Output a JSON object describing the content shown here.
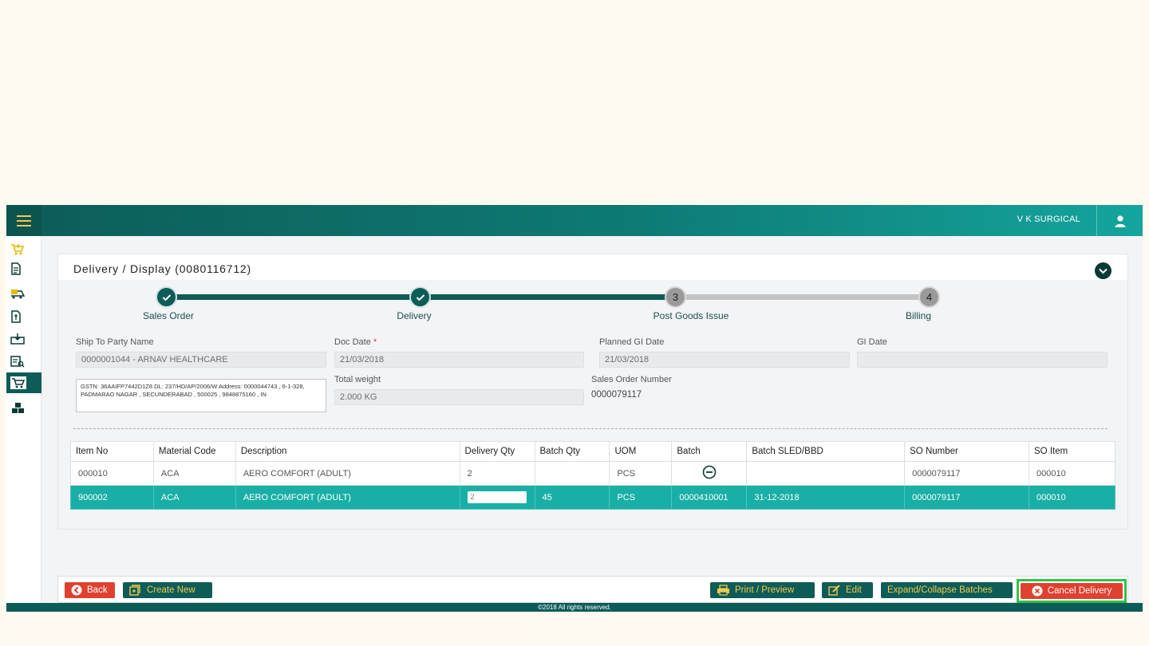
{
  "header": {
    "company": "V K SURGICAL"
  },
  "page": {
    "title": "Delivery / Display (0080116712)"
  },
  "stepper": {
    "steps": [
      {
        "label": "Sales Order",
        "status": "done"
      },
      {
        "label": "Delivery",
        "status": "done"
      },
      {
        "label": "Post Goods Issue",
        "status": "pending",
        "number": "3"
      },
      {
        "label": "Billing",
        "status": "pending",
        "number": "4"
      }
    ]
  },
  "form": {
    "ship_to_label": "Ship To Party Name",
    "ship_to_value": "0000001044 - ARNAV HEALTHCARE",
    "address": "GSTN: 36AAIFP7442D1Z8 DL: 237/HD/AP/2006/W Address: 0000044743 , 6-1-328, PADMARAO NAGAR , SECUNDERABAD , 500025 , 9848875160 , IN",
    "doc_date_label": "Doc Date",
    "doc_date_required": "*",
    "doc_date_value": "21/03/2018",
    "total_weight_label": "Total weight",
    "total_weight_value": "2.000 KG",
    "planned_gi_label": "Planned GI Date",
    "planned_gi_value": "21/03/2018",
    "sales_order_label": "Sales Order Number",
    "sales_order_value": "0000079117",
    "gi_date_label": "GI Date",
    "gi_date_value": ""
  },
  "table": {
    "columns": [
      "Item No",
      "Material Code",
      "Description",
      "Delivery Qty",
      "Batch Qty",
      "UOM",
      "Batch",
      "Batch SLED/BBD",
      "SO Number",
      "SO Item"
    ],
    "rows": [
      [
        "000010",
        "ACA",
        "AERO COMFORT (ADULT)",
        "2",
        "",
        "PCS",
        "",
        "",
        "0000079117",
        "000010"
      ],
      [
        "900002",
        "ACA",
        "AERO COMFORT (ADULT)",
        "2",
        "45",
        "PCS",
        "0000410001",
        "31-12-2018",
        "0000079117",
        "000010"
      ]
    ]
  },
  "footer": {
    "back_label": "Back",
    "create_new_label": "Create New",
    "print_label": "Print / Preview",
    "edit_label": "Edit",
    "expand_label": "Expand/Collapse Batches",
    "cancel_label": "Cancel Delivery",
    "copyright": "©2018 All rights reserved."
  },
  "colors": {
    "brand_dark": "#0d5c58",
    "brand_light": "#14a59d",
    "selected_row": "#1aafa6",
    "danger": "#e0402f",
    "highlight": "#2ec34a"
  }
}
